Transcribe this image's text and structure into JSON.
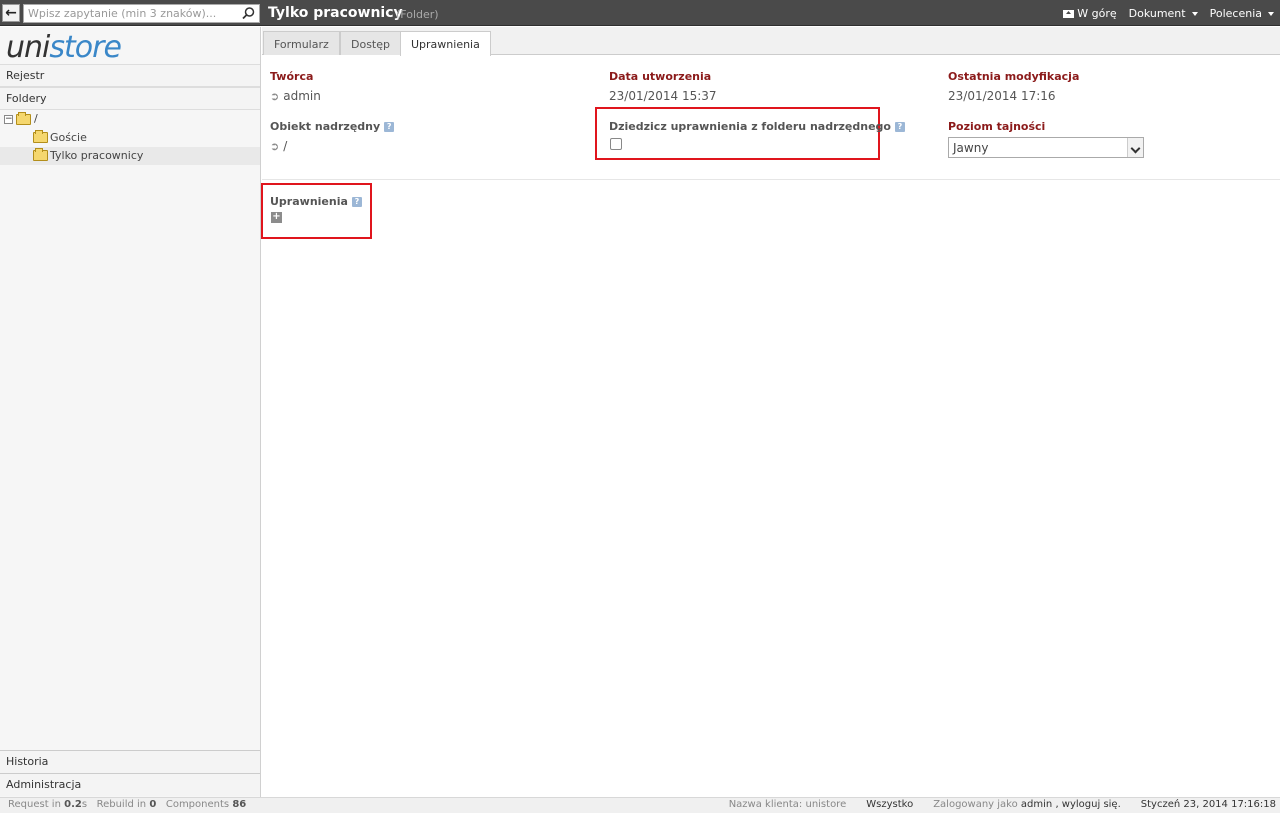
{
  "search": {
    "placeholder": "Wpisz zapytanie (min 3 znaków)..."
  },
  "header": {
    "title": "Tylko pracownicy",
    "subtitle": "(Folder)",
    "menu": [
      {
        "label": "W górę",
        "icon": "folder-up-icon"
      },
      {
        "label": "Dokument"
      },
      {
        "label": "Polecenia"
      }
    ]
  },
  "sidebar": {
    "logo_part1": "uni",
    "logo_part2": "store",
    "sections": [
      "Rejestr",
      "Foldery"
    ],
    "tree": [
      {
        "label": "/",
        "level": 0
      },
      {
        "label": "Goście",
        "level": 1
      },
      {
        "label": "Tylko pracownicy",
        "level": 1,
        "selected": true
      }
    ],
    "bottom": [
      "Historia",
      "Administracja"
    ]
  },
  "tabs": [
    "Formularz",
    "Dostęp",
    "Uprawnienia"
  ],
  "active_tab": "Uprawnienia",
  "fields": {
    "creator_label": "Twórca",
    "creator_value": "admin",
    "created_label": "Data utworzenia",
    "created_value": "23/01/2014 15:37",
    "modified_label": "Ostatnia modyfikacja",
    "modified_value": "23/01/2014 17:16",
    "parent_label": "Obiekt nadrzędny",
    "parent_value": "/",
    "inherit_label": "Dziedzicz uprawnienia z folderu nadrzędnego",
    "inherit_checked": false,
    "secrecy_label": "Poziom tajności",
    "secrecy_value": "Jawny",
    "permissions_label": "Uprawnienia",
    "help_glyph": "?",
    "add_glyph": "+"
  },
  "statusbar": {
    "request_label": "Request in",
    "request_value": "0.2",
    "request_unit": "s",
    "rebuild_label": "Rebuild in",
    "rebuild_value": "0",
    "components_label": "Components",
    "components_value": "86",
    "client": "Nazwa klienta: unistore",
    "scope": "Wszystko",
    "logged_prefix": "Zalogowany jako",
    "logged_user": "admin",
    "logout": ", wyloguj się.",
    "datetime": "Styczeń 23, 2014 17:16:18"
  },
  "colors": {
    "topbar": "#4a4a4a",
    "label_red": "#8b1a1a",
    "highlight": "#e0151d",
    "logo_blue": "#3a87c8"
  }
}
